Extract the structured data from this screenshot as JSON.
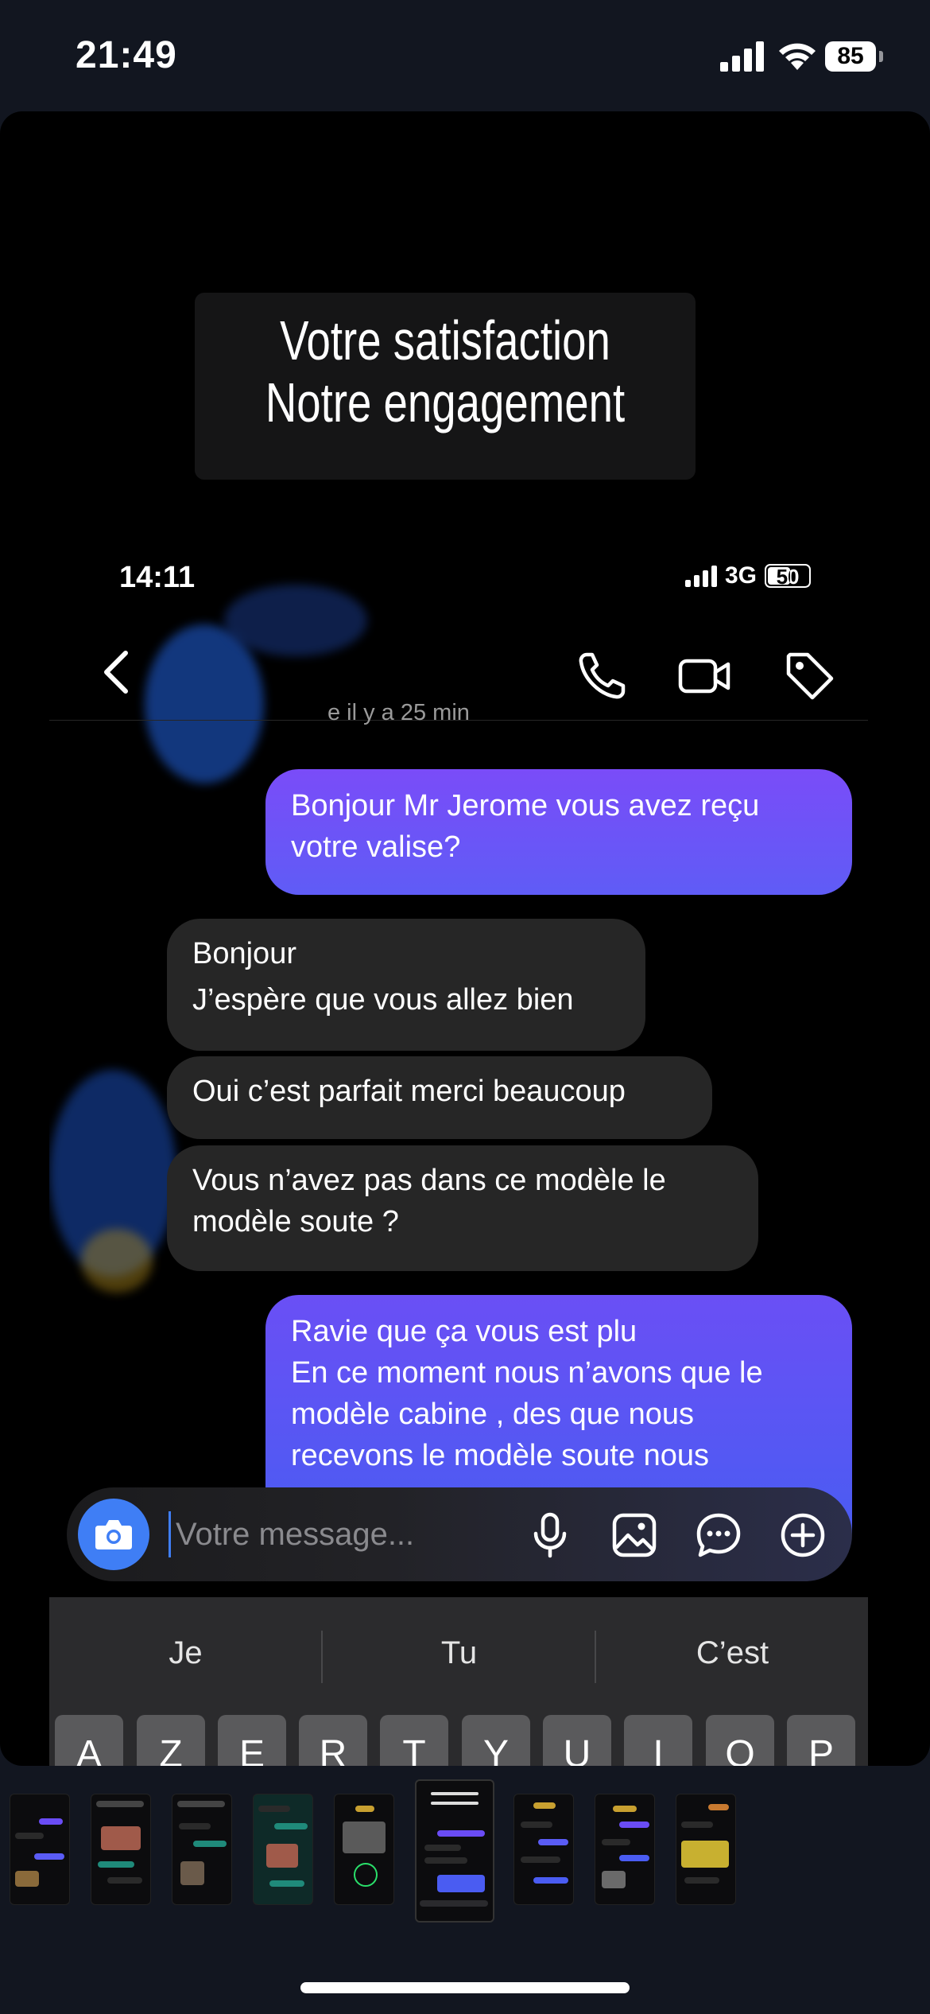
{
  "status_bar": {
    "time": "21:49",
    "battery": "85"
  },
  "story": {
    "caption_lines": [
      "Votre satisfaction",
      "Notre engagement"
    ],
    "screenshot": {
      "status_time": "14:11",
      "network": "3G",
      "battery": "50",
      "last_seen": "e il y a 25 min",
      "messages": [
        {
          "direction": "outgoing",
          "lines": [
            "Bonjour Mr Jerome vous avez reçu",
            "votre valise?"
          ]
        },
        {
          "direction": "incoming",
          "lines": [
            "Bonjour",
            "J’espère que vous allez bien"
          ]
        },
        {
          "direction": "incoming",
          "lines": [
            "Oui c’est parfait merci beaucoup"
          ]
        },
        {
          "direction": "incoming",
          "lines": [
            "Vous n’avez pas dans ce modèle le",
            "modèle soute ?"
          ]
        },
        {
          "direction": "outgoing",
          "lines": [
            "Ravie que ça vous est plu",
            "En ce moment nous n’avons que le",
            "modèle cabine , des que nous",
            "recevons le modèle soute nous"
          ]
        }
      ],
      "composer_placeholder": "Votre message...",
      "keyboard_suggestions": [
        "Je",
        "Tu",
        "C’est"
      ],
      "keyboard_keys": [
        "A",
        "Z",
        "E",
        "R",
        "T",
        "Y",
        "U",
        "I",
        "O",
        "P"
      ]
    }
  },
  "icons": {
    "back": "chevron-left-icon",
    "call": "phone-icon",
    "video": "video-camera-icon",
    "tag": "tag-icon",
    "camera": "camera-icon",
    "mic": "microphone-icon",
    "gallery": "image-icon",
    "sticker": "chat-bubble-icon",
    "add": "plus-circle-icon"
  },
  "colors": {
    "outgoing_bubble": "#7a4cf8",
    "incoming_bubble": "#262626",
    "camera_button": "#3f7ef5",
    "background": "#121620"
  }
}
